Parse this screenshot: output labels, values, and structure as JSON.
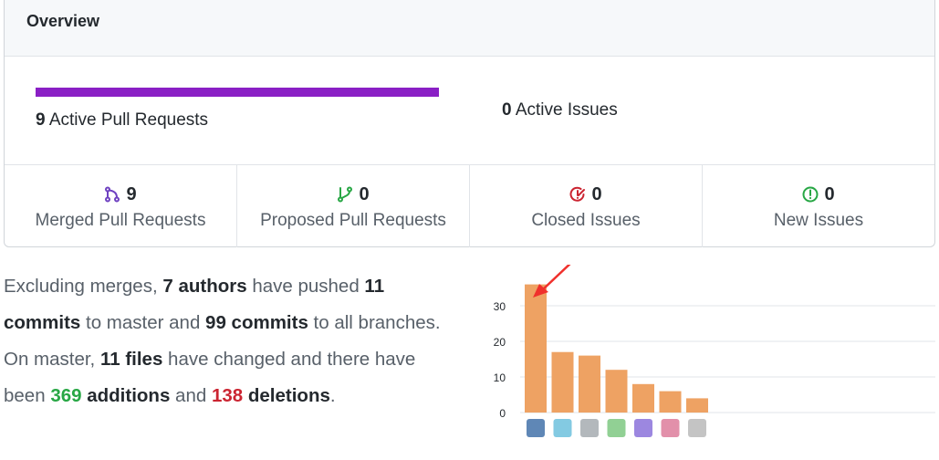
{
  "header": {
    "title": "Overview"
  },
  "activity": {
    "pull_requests": {
      "count": "9",
      "label": "Active Pull Requests"
    },
    "issues": {
      "count": "0",
      "label": "Active Issues"
    }
  },
  "stats": [
    {
      "count": "9",
      "label": "Merged Pull Requests",
      "icon": "merged-pr-icon",
      "color": "#6f42c1"
    },
    {
      "count": "0",
      "label": "Proposed Pull Requests",
      "icon": "open-pr-icon",
      "color": "#28a745"
    },
    {
      "count": "0",
      "label": "Closed Issues",
      "icon": "closed-issue-icon",
      "color": "#cb2431"
    },
    {
      "count": "0",
      "label": "New Issues",
      "icon": "new-issue-icon",
      "color": "#28a745"
    }
  ],
  "summary": {
    "t1": "Excluding merges, ",
    "authors": "7 authors",
    "t2": " have pushed ",
    "master_commits": "11 commits",
    "t3": " to master and ",
    "all_commits": "99 commits",
    "t4": " to all branches. On master, ",
    "files": "11 files",
    "t5": " have changed and there have been ",
    "additions_num": "369",
    "additions_word": "additions",
    "t6": " and ",
    "deletions_num": "138",
    "deletions_word": "deletions",
    "t7": "."
  },
  "colors": {
    "bar": "#eea263",
    "pr_bar": "#8a1fc5",
    "annotation_arrow": "#f0302c"
  },
  "chart_data": {
    "type": "bar",
    "values": [
      36,
      17,
      16,
      12,
      8,
      6,
      4
    ],
    "yticks": [
      "0",
      "10",
      "20",
      "30"
    ],
    "ylim": [
      0,
      40
    ],
    "grid": true,
    "x_labels": "contributor avatars"
  }
}
